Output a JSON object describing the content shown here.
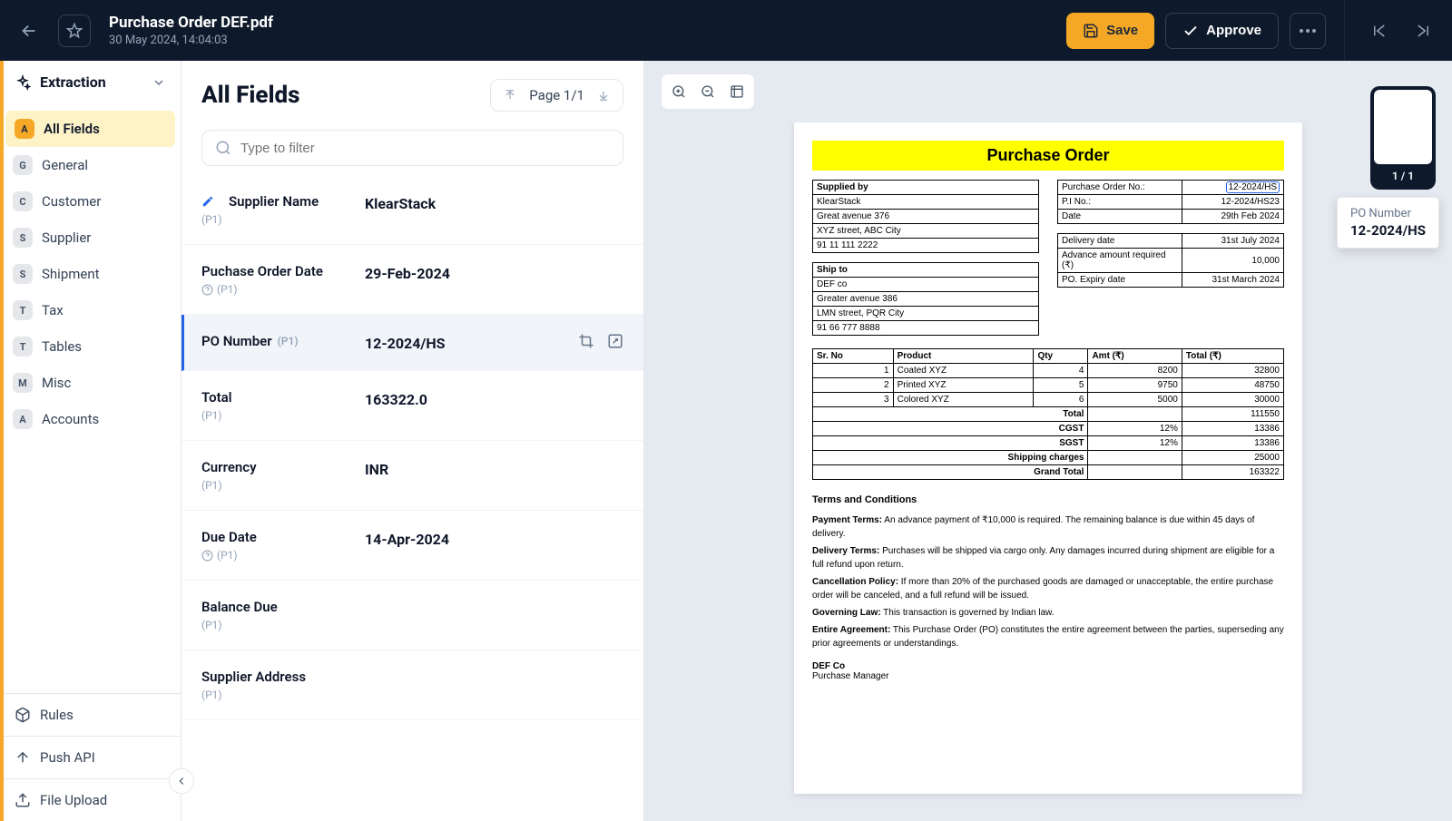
{
  "header": {
    "title": "Purchase Order DEF.pdf",
    "subtitle": "30 May 2024, 14:04:03",
    "save": "Save",
    "approve": "Approve"
  },
  "sidebar": {
    "title": "Extraction",
    "items": [
      {
        "badge": "A",
        "label": "All Fields",
        "active": true
      },
      {
        "badge": "G",
        "label": "General"
      },
      {
        "badge": "C",
        "label": "Customer"
      },
      {
        "badge": "S",
        "label": "Supplier"
      },
      {
        "badge": "S",
        "label": "Shipment"
      },
      {
        "badge": "T",
        "label": "Tax"
      },
      {
        "badge": "T",
        "label": "Tables"
      },
      {
        "badge": "M",
        "label": "Misc"
      },
      {
        "badge": "A",
        "label": "Accounts"
      }
    ],
    "footer": [
      {
        "label": "Rules"
      },
      {
        "label": "Push API"
      },
      {
        "label": "File Upload"
      }
    ]
  },
  "fields": {
    "title": "All Fields",
    "pager": "Page 1/1",
    "filterPlaceholder": "Type to filter",
    "rows": [
      {
        "label": "Supplier Name",
        "page": "(P1)",
        "value": "KlearStack",
        "editing": true
      },
      {
        "label": "Puchase Order Date",
        "page": "(P1)",
        "value": "29-Feb-2024",
        "help": true
      },
      {
        "label": "PO Number",
        "page": "(P1)",
        "value": "12-2024/HS",
        "selected": true
      },
      {
        "label": "Total",
        "page": "(P1)",
        "value": "163322.0"
      },
      {
        "label": "Currency",
        "page": "(P1)",
        "value": "INR"
      },
      {
        "label": "Due Date",
        "page": "(P1)",
        "value": "14-Apr-2024",
        "help": true
      },
      {
        "label": "Balance Due",
        "page": "(P1)",
        "value": ""
      },
      {
        "label": "Supplier Address",
        "page": "(P1)",
        "value": ""
      }
    ]
  },
  "thumb": {
    "label": "1 / 1"
  },
  "tooltip": {
    "label": "PO Number",
    "value": "12-2024/HS"
  },
  "doc": {
    "title": "Purchase Order",
    "supplier": {
      "heading": "Supplied by",
      "name": "KlearStack",
      "addr1": "Great avenue 376",
      "addr2": "XYZ street, ABC City",
      "phone": "91 11 111 2222"
    },
    "ship": {
      "heading": "Ship to",
      "name": "DEF co",
      "addr1": "Greater avenue 386",
      "addr2": "LMN street, PQR City",
      "phone": "91 66 777 8888"
    },
    "meta": {
      "poNoLabel": "Purchase Order No.:",
      "poNo": "12-2024/HS",
      "piNoLabel": "P.I No.:",
      "piNo": "12-2024/HS23",
      "dateLabel": "Date",
      "date": "29th Feb 2024",
      "deliveryLabel": "Delivery date",
      "delivery": "31st July 2024",
      "advanceLabel": "Advance amount required (₹)",
      "advance": "10,000",
      "expiryLabel": "PO. Expiry date",
      "expiry": "31st March 2024"
    },
    "lineHeaders": [
      "Sr. No",
      "Product",
      "Qty",
      "Amt (₹)",
      "Total (₹)"
    ],
    "lines": [
      {
        "sr": "1",
        "product": "Coated XYZ",
        "qty": "4",
        "amt": "8200",
        "total": "32800"
      },
      {
        "sr": "2",
        "product": "Printed XYZ",
        "qty": "5",
        "amt": "9750",
        "total": "48750"
      },
      {
        "sr": "3",
        "product": "Colored XYZ",
        "qty": "6",
        "amt": "5000",
        "total": "30000"
      }
    ],
    "totals": [
      {
        "label": "Total",
        "extra": "",
        "value": "111550"
      },
      {
        "label": "CGST",
        "extra": "12%",
        "value": "13386"
      },
      {
        "label": "SGST",
        "extra": "12%",
        "value": "13386"
      },
      {
        "label": "Shipping charges",
        "extra": "",
        "value": "25000"
      },
      {
        "label": "Grand Total",
        "extra": "",
        "value": "163322"
      }
    ],
    "terms": {
      "heading": "Terms and Conditions",
      "payment": "Payment Terms:",
      "paymentText": " An advance payment of ₹10,000 is required. The remaining balance is due within 45 days of delivery.",
      "delivery": "Delivery Terms:",
      "deliveryText": " Purchases will be shipped via cargo only. Any damages incurred during shipment are eligible for a full refund upon return.",
      "cancel": "Cancellation Policy:",
      "cancelText": " If more than 20% of the purchased goods are damaged or unacceptable, the entire purchase order will be canceled, and a full refund will be issued.",
      "law": "Governing Law:",
      "lawText": " This transaction is governed by Indian law.",
      "agreement": "Entire Agreement:",
      "agreementText": " This Purchase Order (PO) constitutes the entire agreement between the parties, superseding any prior agreements or understandings."
    },
    "sig": {
      "company": "DEF Co",
      "role": "Purchase Manager"
    }
  }
}
